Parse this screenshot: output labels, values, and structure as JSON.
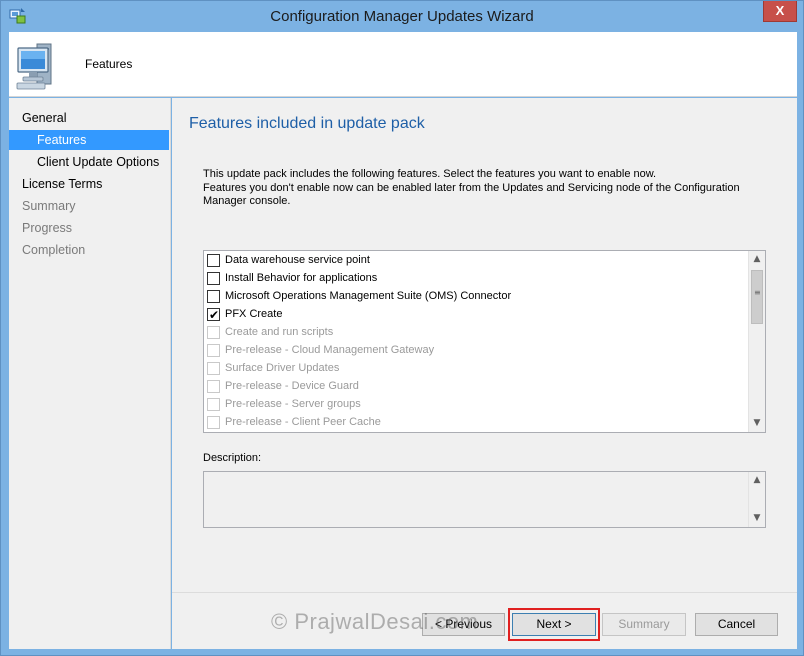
{
  "window": {
    "title": "Configuration Manager Updates Wizard",
    "close_glyph": "X"
  },
  "header": {
    "title": "Features"
  },
  "nav": {
    "items": [
      {
        "label": "General"
      },
      {
        "label": "Features"
      },
      {
        "label": "Client Update Options"
      },
      {
        "label": "License Terms"
      },
      {
        "label": "Summary"
      },
      {
        "label": "Progress"
      },
      {
        "label": "Completion"
      }
    ]
  },
  "main": {
    "title": "Features included in update pack",
    "intro_line1": "This update pack includes the following features. Select the features you want to enable now.",
    "intro_line2": "Features you don't enable now can be enabled later from the Updates and Servicing node of the Configuration Manager console.",
    "features": [
      {
        "label": "Data warehouse service point",
        "checked": false,
        "enabled": true
      },
      {
        "label": "Install Behavior for applications",
        "checked": false,
        "enabled": true
      },
      {
        "label": "Microsoft Operations Management Suite (OMS) Connector",
        "checked": false,
        "enabled": true
      },
      {
        "label": "PFX Create",
        "checked": true,
        "enabled": true
      },
      {
        "label": "Create and run scripts",
        "checked": false,
        "enabled": false
      },
      {
        "label": "Pre-release - Cloud Management Gateway",
        "checked": false,
        "enabled": false
      },
      {
        "label": "Surface Driver Updates",
        "checked": false,
        "enabled": false
      },
      {
        "label": "Pre-release - Device Guard",
        "checked": false,
        "enabled": false
      },
      {
        "label": "Pre-release - Server groups",
        "checked": false,
        "enabled": false
      },
      {
        "label": "Pre-release - Client Peer Cache",
        "checked": false,
        "enabled": false
      }
    ],
    "description_label": "Description:"
  },
  "footer": {
    "previous_label": "< Previous",
    "next_label": "Next >",
    "summary_label": "Summary",
    "cancel_label": "Cancel"
  },
  "watermark": "© PrajwalDesai.com",
  "icons": {
    "app": "wizard-app-icon",
    "header": "computer-monitor-icon",
    "scroll_up": "▲",
    "scroll_down": "▼"
  }
}
